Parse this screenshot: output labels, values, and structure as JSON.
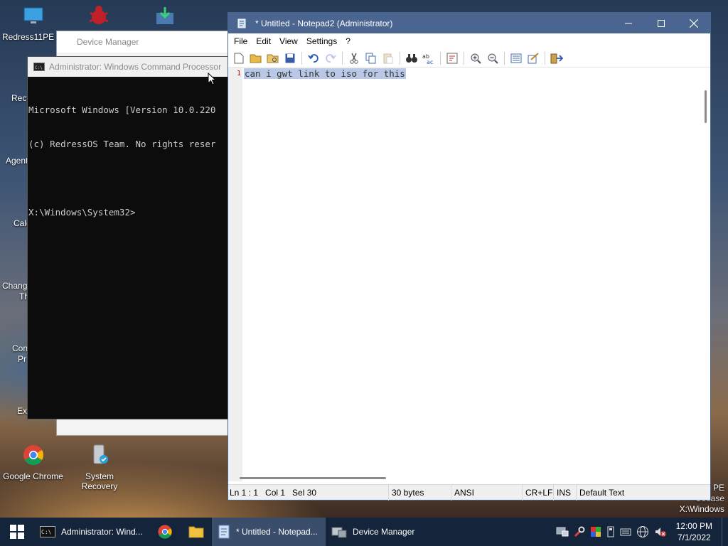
{
  "desktop": {
    "icons": [
      {
        "label": "Redress11PE P"
      },
      {
        "label": "Google Chrome"
      },
      {
        "label": "System Recovery"
      }
    ],
    "left_labels": [
      "Recy",
      "Agent",
      "Calc",
      "Chang",
      "Th",
      "Con",
      "Pr",
      "Exp"
    ],
    "right_text": [
      "PE",
      "Osease",
      "X:\\Windows"
    ]
  },
  "device_manager": {
    "title": "Device Manager"
  },
  "cmd": {
    "title": "Administrator: Windows Command Processor",
    "lines": [
      "Microsoft Windows [Version 10.0.220",
      "(c) RedressOS Team. No rights reser",
      "",
      "X:\\Windows\\System32>"
    ]
  },
  "notepad": {
    "title": "* Untitled - Notepad2 (Administrator)",
    "menu": [
      "File",
      "Edit",
      "View",
      "Settings",
      "?"
    ],
    "line_number": "1",
    "text": "can i gwt link to iso for this",
    "status": {
      "position": "Ln 1 : 1   Col 1   Sel 30",
      "size": "30 bytes",
      "encoding": "ANSI",
      "eol": "CR+LF",
      "mode": "INS",
      "scheme": "Default Text"
    }
  },
  "taskbar": {
    "items": [
      {
        "label": "Administrator: Wind..."
      },
      {
        "label": "* Untitled - Notepad..."
      },
      {
        "label": "Device Manager"
      }
    ],
    "clock": {
      "time": "12:00 PM",
      "date": "7/1/2022"
    }
  },
  "colors": {
    "notepad_titlebar": "#4a6690",
    "selection": "#b8c8e6",
    "taskbar": "#14243b",
    "console_bg": "#0c0c0c"
  }
}
